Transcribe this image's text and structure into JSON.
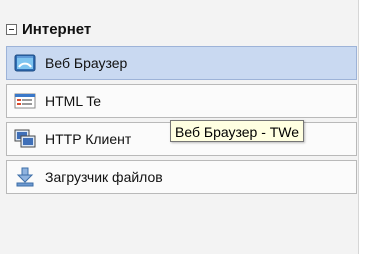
{
  "group": {
    "title": "Интернет"
  },
  "items": [
    {
      "label": "Веб Браузер",
      "icon": "web-browser-icon"
    },
    {
      "label": "HTML Te",
      "icon": "html-template-icon"
    },
    {
      "label": "HTTP Клиент",
      "icon": "http-client-icon"
    },
    {
      "label": "Загрузчик файлов",
      "icon": "file-downloader-icon"
    }
  ],
  "tooltip": {
    "text": "Веб Браузер - TWe"
  },
  "colors": {
    "selected_bg": "#c9d9f1",
    "tooltip_bg": "#ffffe1"
  }
}
